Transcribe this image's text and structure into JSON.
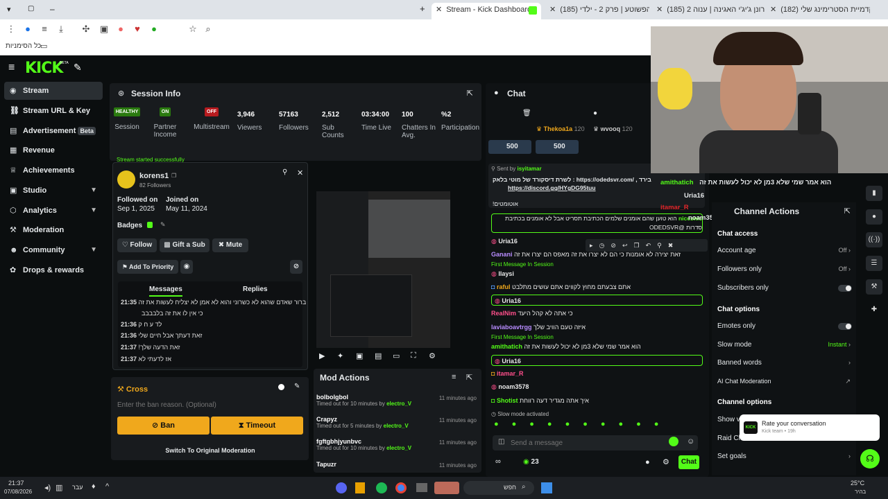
{
  "browser": {
    "tabs": [
      {
        "title": "Stream - Kick Dashboard",
        "active": true
      },
      {
        "title": "(185) הפשוטע | פרק 2 - ילדי",
        "active": false
      },
      {
        "title": "(185) רונן ג'יג'י האגינה | ענוה 2",
        "active": false
      },
      {
        "title": "(182) אקדמיית הסטרימינג שלי",
        "active": false
      }
    ],
    "bookmarks_label": "כל הסימניות"
  },
  "kick": {
    "logo": "KICK",
    "logo_tag": "BETA"
  },
  "sidebar": {
    "items": [
      {
        "label": "Stream",
        "icon": "broadcast-icon",
        "active": true
      },
      {
        "label": "Stream URL & Key",
        "icon": "link-icon"
      },
      {
        "label": "Advertisement",
        "icon": "ad-icon",
        "badge": "Beta"
      },
      {
        "label": "Revenue",
        "icon": "revenue-icon"
      },
      {
        "label": "Achievements",
        "icon": "trophy-icon"
      },
      {
        "label": "Studio",
        "icon": "studio-icon",
        "expandable": true
      },
      {
        "label": "Analytics",
        "icon": "analytics-icon",
        "expandable": true
      },
      {
        "label": "Moderation",
        "icon": "hammer-icon"
      },
      {
        "label": "Community",
        "icon": "community-icon",
        "expandable": true
      },
      {
        "label": "Drops & rewards",
        "icon": "gift-icon"
      }
    ]
  },
  "session": {
    "title": "Session Info",
    "stats": [
      {
        "badge": "HEALTHY",
        "label": "Session",
        "color": "#53fc18"
      },
      {
        "badge": "ON",
        "label": "Partner Income",
        "color": "#53fc18"
      },
      {
        "badge": "OFF",
        "label": "Multistream",
        "color": "#e5262a"
      },
      {
        "value": "3,946",
        "label": "Viewers"
      },
      {
        "value": "57163",
        "label": "Followers"
      },
      {
        "value": "2,512",
        "label": "Sub Counts"
      },
      {
        "value": "03:34:00",
        "label": "Time Live"
      },
      {
        "value": "100",
        "label": "Chatters In Avg."
      },
      {
        "value": "%2",
        "label": "Participation"
      }
    ],
    "banner": "Stream started successfully"
  },
  "user_card": {
    "username": "korens1",
    "followers": "82 Followers",
    "followed_on_label": "Followed on",
    "followed_on": "Sep 1, 2025",
    "joined_on_label": "Joined on",
    "joined_on": "May 11, 2024",
    "badges_label": "Badges",
    "follow": "Follow",
    "gift_sub": "Gift a Sub",
    "mute": "Mute",
    "add_priority": "Add To Priority",
    "tab_messages": "Messages",
    "tab_replies": "Replies",
    "messages": [
      {
        "time": "21:35",
        "text": "ברור שאדם שהוא לא כשרוני והוא לא אמן לא יצליח לעשות את זה"
      },
      {
        "time": "",
        "text": "כי אין לו את זה בלבבבב"
      },
      {
        "time": "21:36",
        "text": "לד ע ח ק"
      },
      {
        "time": "21:36",
        "text": "זאת דעתך אבל חיים שלי"
      },
      {
        "time": "21:37",
        "text": "!זאת הדעה שלך"
      },
      {
        "time": "21:37",
        "text": "אז לדעתי לא"
      }
    ]
  },
  "ban_box": {
    "title": "Cross",
    "reason_placeholder": "Enter the ban reason. (Optional)",
    "ban": "Ban",
    "timeout": "Timeout",
    "switch": "Switch To Original Moderation"
  },
  "mod_actions": {
    "title": "Mod Actions",
    "items": [
      {
        "name": "bolbolgbol",
        "desc": "Timed out for 10 minutes by",
        "by": "electro_V",
        "time": "11 minutes ago"
      },
      {
        "name": "Crapyz",
        "desc": "Timed out for 5 minutes by",
        "by": "electro_V",
        "time": "11 minutes ago"
      },
      {
        "name": "fgftgbhjyunbvc",
        "desc": "Timed out for 10 minutes by",
        "by": "electro_V",
        "time": "11 minutes ago"
      },
      {
        "name": "Tapuzr",
        "desc": "",
        "by": "",
        "time": "11 minutes ago"
      }
    ]
  },
  "chat": {
    "title": "Chat",
    "top_gifters": [
      {
        "name": "Thekoa1a",
        "count": "120"
      },
      {
        "name": "wvooq",
        "count": "120"
      }
    ],
    "goal_a": "500",
    "goal_b": "500",
    "pinned_sent_by": "Sent by",
    "pinned_user": "isyitamar",
    "pinned_line1": "לשרת דיסקורד של מוטי בלאק : https://odedsvr.com/ , בירד",
    "pinned_link1": "https://odedsvr.com/",
    "pinned_link2": "https://discord.gg/HYgDG95tuu",
    "pinned_line3": "!אוטומטים",
    "messages": [
      {
        "user": "nicesnic",
        "text": "הוא טוען שהם אומנים שלמים הכתיבת תסריט אבל לא אומנים בכתיבת סדרות @ODEDSVR",
        "highlight": true
      },
      {
        "user": "Uria16",
        "text": "",
        "highlight": false
      },
      {
        "user": "Ganani",
        "text": "זאת יצירה לא אומנות כי הם לא יצרו את זה מאפס הם יצרו את זה"
      },
      {
        "first": "First Message In Session"
      },
      {
        "user": "Ilaysi",
        "text": ""
      },
      {
        "user": "raful",
        "text": "אתם צבעתם מחוץ לקווים אתם עושים מתלבט"
      },
      {
        "user": "Uria16",
        "text": "",
        "highlight": true
      },
      {
        "user": "RealNim",
        "text": "כי אתה לא קהל היעד"
      },
      {
        "user": "laviaboavtrgg",
        "text": "איזה טעם הוויב שלך"
      },
      {
        "first": "First Message In Session"
      },
      {
        "user": "amithatich",
        "text": "הוא אמר שמי שלא 3מן לא יכול לעשות את זה"
      },
      {
        "user": "Uria16",
        "text": "",
        "highlight": true
      },
      {
        "user": "itamar_R",
        "text": ""
      },
      {
        "user": "noam3578",
        "text": ""
      },
      {
        "user": "Shotist",
        "text": "איך אתה מגדיר דעה רווחת"
      }
    ],
    "slow_mode": "Slow mode activated",
    "send_placeholder": "Send a message",
    "points": "23",
    "send_button": "Chat"
  },
  "overlay_chat": [
    {
      "user": "amithatich",
      "text": "הוא אמר שמי שלא 3מן לא יכול לעשות את זה"
    },
    {
      "user": "Uria16",
      "text": ""
    },
    {
      "user": "itamar_R",
      "text": ""
    },
    {
      "user": "noam3578",
      "text": ""
    }
  ],
  "channel_actions": {
    "title": "Channel Actions",
    "chat_access": "Chat access",
    "account_age": "Account age",
    "account_age_val": "Off",
    "followers_only": "Followers only",
    "followers_only_val": "Off",
    "subscribers_only": "Subscribers only",
    "chat_options": "Chat options",
    "emotes_only": "Emotes only",
    "slow_mode": "Slow mode",
    "slow_mode_val": "Instant",
    "banned_words": "Banned words",
    "ai_mod": "AI Chat Moderation",
    "channel_options": "Channel options",
    "show_label": "Show v",
    "raid_label": "Raid Cha",
    "set_goals": "Set goals"
  },
  "toast": {
    "title": "Rate your conversation",
    "sub": "Kick team • 19h"
  },
  "taskbar": {
    "time": "21:37",
    "date": "07/08/2026",
    "lang": "עבר",
    "search": "חפש",
    "weather": "25°C",
    "weather_desc": "בהיר"
  },
  "colors": {
    "accent": "#53fc18",
    "bg": "#0b0e0f",
    "panel": "#181b1e",
    "ban": "#f0a81c",
    "danger": "#e5262a"
  }
}
